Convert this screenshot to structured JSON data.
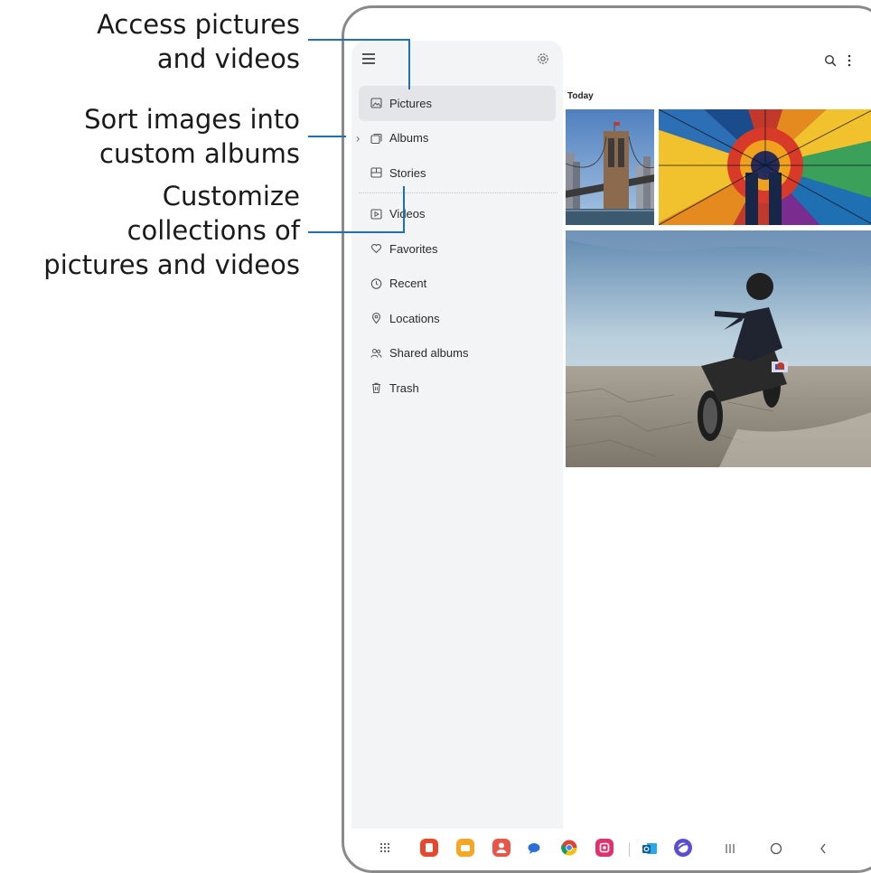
{
  "callouts": {
    "pictures": [
      "Access pictures",
      "and videos"
    ],
    "albums": [
      "Sort images into",
      "custom albums"
    ],
    "stories": [
      "Customize",
      "collections of",
      "pictures and videos"
    ]
  },
  "drawer": {
    "items": [
      {
        "label": "Pictures",
        "icon": "image-icon",
        "active": true
      },
      {
        "label": "Albums",
        "icon": "albums-icon",
        "expandable": true
      },
      {
        "label": "Stories",
        "icon": "stories-icon"
      },
      {
        "label": "Videos",
        "icon": "video-icon"
      },
      {
        "label": "Favorites",
        "icon": "heart-icon"
      },
      {
        "label": "Recent",
        "icon": "clock-icon"
      },
      {
        "label": "Locations",
        "icon": "location-pin-icon"
      },
      {
        "label": "Shared albums",
        "icon": "shared-people-icon"
      },
      {
        "label": "Trash",
        "icon": "trash-icon"
      }
    ]
  },
  "content": {
    "section_label": "Today",
    "photos": [
      "brooklyn-bridge-photo",
      "stained-glass-dome-photo",
      "motorcycle-rider-photo"
    ]
  },
  "bottom_bar": {
    "apps": [
      "app-drawer-icon",
      "notes-app-icon",
      "my-files-app-icon",
      "contacts-app-icon",
      "messages-app-icon",
      "chrome-app-icon",
      "screen-recorder-app-icon",
      "outlook-app-icon",
      "internet-app-icon"
    ],
    "nav": [
      "recents-button",
      "home-button",
      "back-button"
    ]
  },
  "colors": {
    "accent_line": "#1f6fb3",
    "drawer_bg": "#f3f4f6",
    "active_item_bg": "#e4e5e8"
  }
}
